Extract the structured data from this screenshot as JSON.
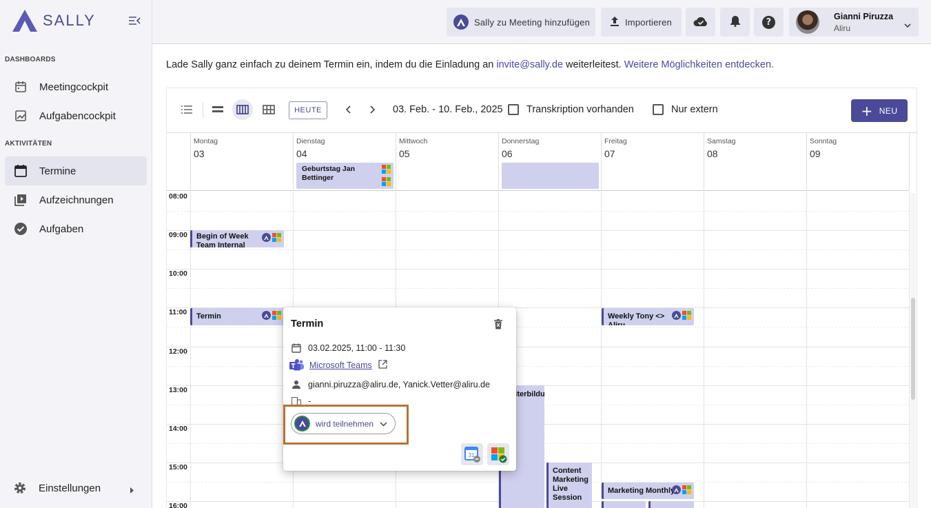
{
  "app": {
    "logo_text": "SALLY"
  },
  "sidebar": {
    "section_dashboards": "DASHBOARDS",
    "section_activities": "AKTIVITÄTEN",
    "items": [
      {
        "label": "Meetingcockpit",
        "icon": "calendar-icon"
      },
      {
        "label": "Aufgabencockpit",
        "icon": "chart-icon"
      },
      {
        "label": "Termine",
        "icon": "calendar-icon",
        "active": true
      },
      {
        "label": "Aufzeichnungen",
        "icon": "video-library-icon"
      },
      {
        "label": "Aufgaben",
        "icon": "check-circle-icon"
      }
    ],
    "settings_label": "Einstellungen"
  },
  "topbar": {
    "add_meeting_label": "Sally zu Meeting hinzufügen",
    "import_label": "Importieren",
    "user_name": "Gianni Piruzza",
    "user_org": "Aliru"
  },
  "info": {
    "text_before": "Lade Sally ganz einfach zu deinem Termin ein, indem du die Einladung an ",
    "email": "invite@sally.de",
    "text_after": " weiterleitest. ",
    "link": "Weitere Möglichkeiten entdecken."
  },
  "calendar": {
    "today_label": "HEUTE",
    "date_range": "03. Feb. - 10. Feb., 2025",
    "filter_transcription": "Transkription vorhanden",
    "filter_external": "Nur extern",
    "new_label": "NEU",
    "days": [
      {
        "name": "Montag",
        "date": "03"
      },
      {
        "name": "Dienstag",
        "date": "04"
      },
      {
        "name": "Mittwoch",
        "date": "05"
      },
      {
        "name": "Donnerstag",
        "date": "06"
      },
      {
        "name": "Freitag",
        "date": "07"
      },
      {
        "name": "Samstag",
        "date": "08"
      },
      {
        "name": "Sonntag",
        "date": "09"
      }
    ],
    "times": [
      "08:00",
      "09:00",
      "10:00",
      "11:00",
      "12:00",
      "13:00",
      "14:00",
      "15:00",
      "16:00"
    ],
    "allday_events": [
      {
        "title": "Geburtstag Jan Bettinger"
      }
    ],
    "events": [
      {
        "title": "Begin of Week Team Internal"
      },
      {
        "title": "Termin"
      },
      {
        "title": "Weekly Tony <> Aliru"
      },
      {
        "title": "Weiterbildung"
      },
      {
        "title": "Content Marketing Live Session"
      },
      {
        "title": "Marketing Monthly"
      }
    ]
  },
  "popup": {
    "title": "Termin",
    "datetime": "03.02.2025, 11:00 - 11:30",
    "location_link": "Microsoft Teams",
    "attendees": "gianni.piruzza@aliru.de, Yanick.Vetter@aliru.de",
    "room": "-",
    "sally_status": "wird teilnehmen"
  },
  "colors": {
    "accent": "#4a4a98",
    "event_bg": "#cfd0ee",
    "highlight": "#b87333"
  }
}
